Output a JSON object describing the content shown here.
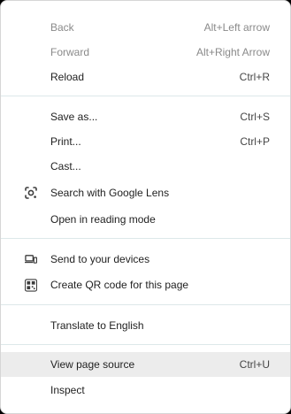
{
  "menu": {
    "back": {
      "label": "Back",
      "shortcut": "Alt+Left arrow"
    },
    "forward": {
      "label": "Forward",
      "shortcut": "Alt+Right Arrow"
    },
    "reload": {
      "label": "Reload",
      "shortcut": "Ctrl+R"
    },
    "save_as": {
      "label": "Save as...",
      "shortcut": "Ctrl+S"
    },
    "print": {
      "label": "Print...",
      "shortcut": "Ctrl+P"
    },
    "cast": {
      "label": "Cast..."
    },
    "search_lens": {
      "label": "Search with Google Lens",
      "icon": "google-lens-icon"
    },
    "reading_mode": {
      "label": "Open in reading mode"
    },
    "send_devices": {
      "label": "Send to your devices",
      "icon": "devices-icon"
    },
    "qr_code": {
      "label": "Create QR code for this page",
      "icon": "qr-code-icon"
    },
    "translate": {
      "label": "Translate to English"
    },
    "view_source": {
      "label": "View page source",
      "shortcut": "Ctrl+U"
    },
    "inspect": {
      "label": "Inspect"
    }
  }
}
